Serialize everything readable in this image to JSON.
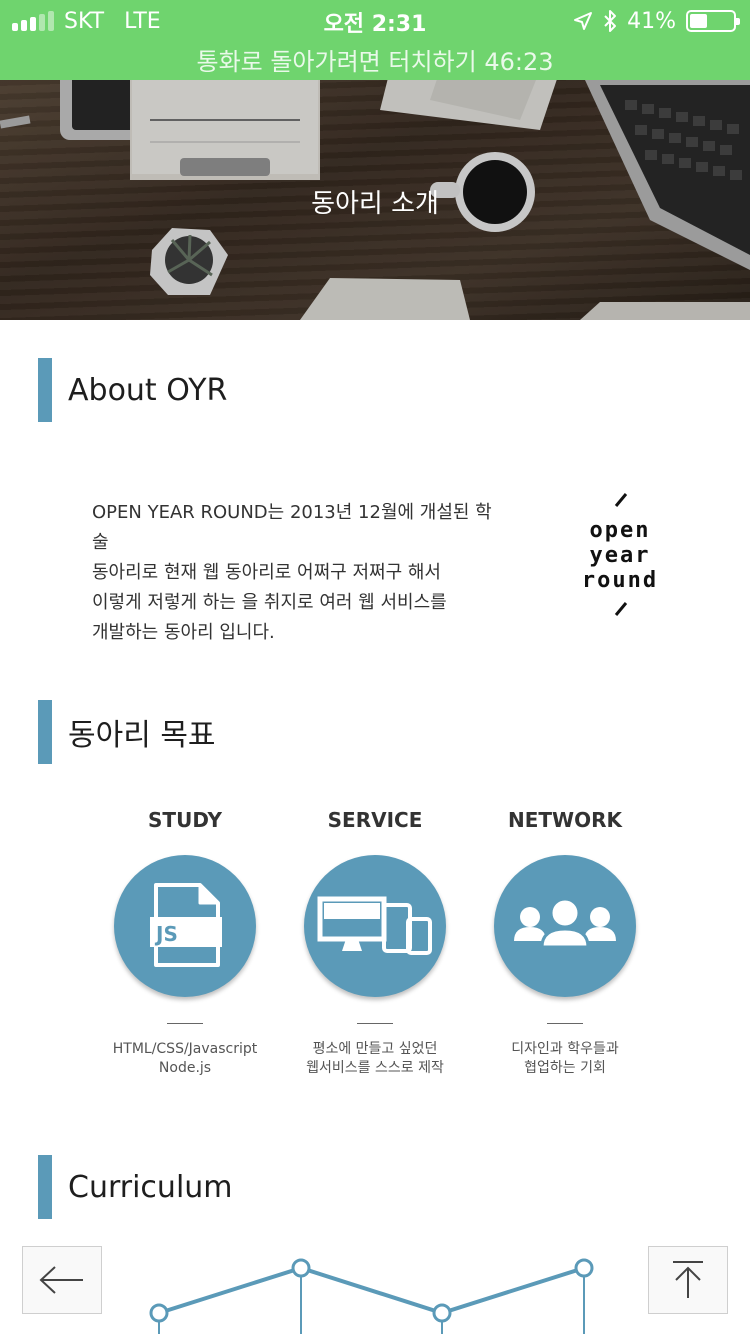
{
  "status_bar": {
    "carrier": "SKT",
    "network": "LTE",
    "time": "오전 2:31",
    "battery": "41%",
    "battery_level": 0.41,
    "call_banner": "통화로 돌아가려면 터치하기 46:23"
  },
  "hero": {
    "title": "동아리 소개"
  },
  "about": {
    "heading": "About OYR",
    "lines": [
      "OPEN YEAR ROUND는 2013년 12월에 개설된 학술",
      "동아리로 현재 웹 동아리로 어쩌구 저쩌구 해서",
      "이렇게 저렇게 하는 을 취지로 여러 웹 서비스를",
      "개발하는 동아리 입니다."
    ],
    "logo_lines": [
      "open",
      "year",
      "round"
    ]
  },
  "goals": {
    "heading": "동아리 목표",
    "items": [
      {
        "title": "STUDY",
        "icon": "js-file-icon",
        "desc": "HTML/CSS/Javascript\nNode.js"
      },
      {
        "title": "SERVICE",
        "icon": "devices-icon",
        "desc": "평소에 만들고 싶었던\n웹서비스를 스스로 제작"
      },
      {
        "title": "NETWORK",
        "icon": "people-icon",
        "desc": "디자인과 학우들과\n협업하는 기회"
      }
    ]
  },
  "curriculum": {
    "heading": "Curriculum"
  },
  "nav": {
    "back_icon": "arrow-left-icon",
    "top_icon": "arrow-up-icon"
  },
  "colors": {
    "status_bar": "#6fd46e",
    "accent": "#5b9ab8"
  }
}
